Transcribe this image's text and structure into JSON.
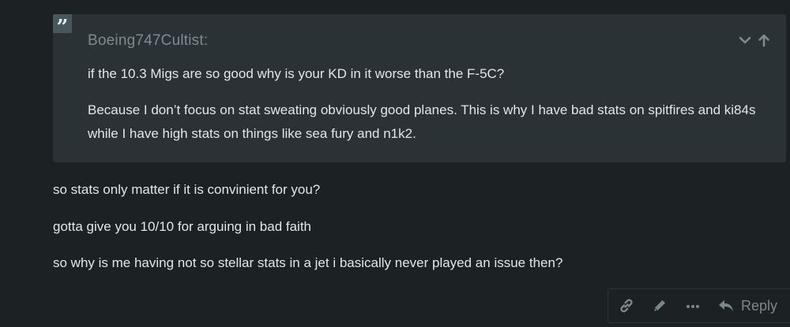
{
  "quote": {
    "badge": "”",
    "author": "Boeing747Cultist:",
    "lines": [
      "if the 10.3 Migs are so good why is your KD in it worse than the F-5C?",
      "Because I don’t focus on stat sweating obviously good planes. This is why I have bad stats on spitfires and ki84s while I have high stats on things like sea fury and n1k2."
    ],
    "controls": [
      "chevron-down-icon",
      "arrow-up-icon"
    ]
  },
  "body": {
    "paragraphs": [
      "so stats only matter if it is convinient for you?",
      "gotta give you 10/10 for arguing in bad faith",
      "so why is me having not so stellar stats in a jet i basically never played an issue then?"
    ]
  },
  "actions": {
    "icons": [
      "link-icon",
      "pencil-icon",
      "more-icon",
      "reply-icon"
    ],
    "reply_label": "Reply"
  },
  "colors": {
    "background": "#1c2123",
    "quote_background": "#2a3235",
    "muted_text": "#7f8b8f",
    "text": "#e3e6e7"
  }
}
